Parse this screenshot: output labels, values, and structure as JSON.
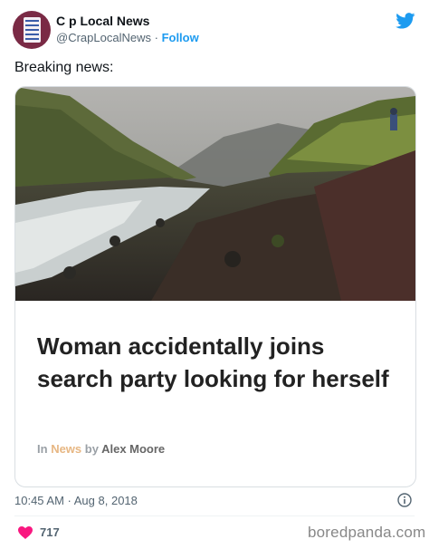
{
  "author": {
    "name": "C  p Local News",
    "handle": "@CrapLocalNews",
    "separator": "·",
    "follow_label": "Follow"
  },
  "tweet": {
    "text": "Breaking news:"
  },
  "article": {
    "headline": "Woman accidentally joins search party looking for herself",
    "byline_prefix": "In",
    "category": "News",
    "byline_by": "by",
    "author": "Alex Moore"
  },
  "meta": {
    "timestamp": "10:45 AM · Aug 8, 2018",
    "likes": "717"
  },
  "watermark": "boredpanda.com",
  "colors": {
    "twitter_blue": "#1d9bf0",
    "like_pink": "#f91880",
    "avatar_bg": "#7a2a45"
  },
  "icons": {
    "logo": "twitter-bird-icon",
    "info": "info-icon",
    "like": "heart-icon"
  }
}
